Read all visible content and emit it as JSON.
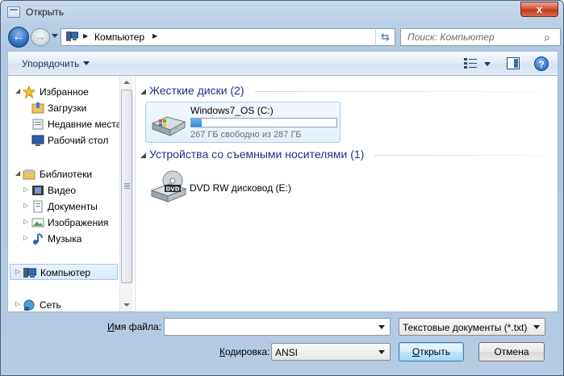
{
  "window": {
    "title": "Открыть",
    "close_glyph": "x"
  },
  "address_bar": {
    "crumb": "Компьютер",
    "sep_glyph": "▶"
  },
  "search": {
    "placeholder": "Поиск: Компьютер"
  },
  "toolbar": {
    "organize_label": "Упорядочить"
  },
  "nav_pane": {
    "items": [
      {
        "label": "Избранное",
        "icon": "star-icon"
      },
      {
        "label": "Загрузки",
        "icon": "downloads-folder-icon"
      },
      {
        "label": "Недавние места",
        "icon": "recent-places-icon"
      },
      {
        "label": "Рабочий стол",
        "icon": "desktop-icon"
      },
      {
        "label": "Библиотеки",
        "icon": "libraries-icon"
      },
      {
        "label": "Видео",
        "icon": "video-library-icon"
      },
      {
        "label": "Документы",
        "icon": "documents-library-icon"
      },
      {
        "label": "Изображения",
        "icon": "pictures-library-icon"
      },
      {
        "label": "Музыка",
        "icon": "music-library-icon"
      },
      {
        "label": "Компьютер",
        "icon": "computer-icon",
        "selected": true
      },
      {
        "label": "Сеть",
        "icon": "network-icon"
      }
    ]
  },
  "main": {
    "groups": [
      {
        "title": "Жесткие диски (2)"
      },
      {
        "title": "Устройства со съемными носителями (1)"
      }
    ],
    "drive_c": {
      "name": "Windows7_OS (C:)",
      "free_text": "267 ГБ свободно из 287 ГБ",
      "used_fraction": 0.07
    },
    "dvd": {
      "name": "DVD RW дисковод (E:)",
      "badge": "DVD"
    }
  },
  "bottom": {
    "filename_label": {
      "pre": "",
      "underlined": "И",
      "post": "мя файла:"
    },
    "filename_value": "",
    "filetype_value": "Текстовые документы (*.txt)",
    "encoding_label": {
      "pre": "",
      "underlined": "К",
      "post": "одировка:"
    },
    "encoding_value": "ANSI",
    "open_label": {
      "pre": "",
      "underlined": "О",
      "post": "ткрыть"
    },
    "cancel_label": "Отмена"
  },
  "colors": {
    "link_blue": "#1e3287",
    "selection": "#d6e8fb",
    "progress_fill": "#2a8ad9"
  }
}
